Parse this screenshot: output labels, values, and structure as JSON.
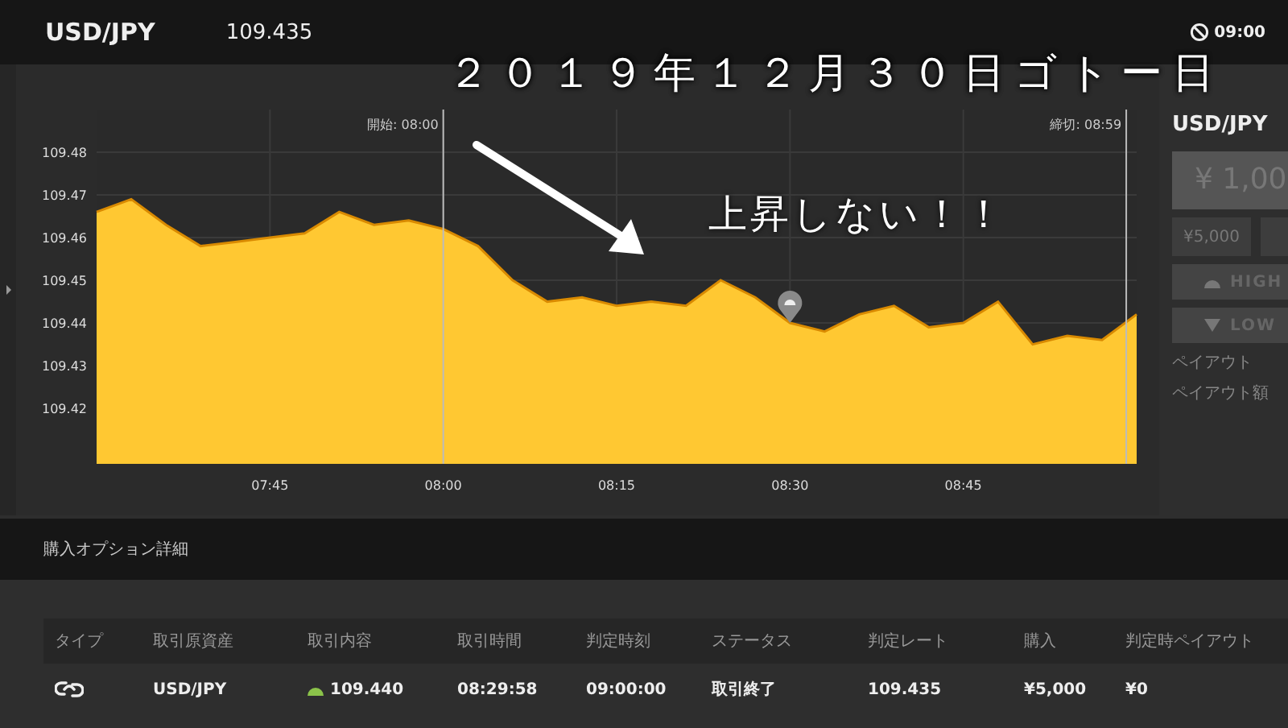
{
  "header": {
    "symbol": "USD/JPY",
    "price": "109.435",
    "expiry": "09:00"
  },
  "overlay": {
    "title": "２０１９年１２月３０日ゴトー日",
    "caption": "上昇しない！！"
  },
  "chart": {
    "chart_data": {
      "type": "area",
      "categories": [
        null,
        null,
        null,
        null,
        null,
        "07:45",
        null,
        null,
        null,
        null,
        "08:00",
        null,
        null,
        null,
        null,
        "08:15",
        null,
        null,
        null,
        null,
        "08:30",
        null,
        null,
        null,
        null,
        "08:45",
        null,
        null,
        null,
        null,
        null
      ],
      "series": [
        {
          "color": "#ffc832",
          "values": [
            109.466,
            109.469,
            109.463,
            109.458,
            109.459,
            109.46,
            109.461,
            109.466,
            109.463,
            109.464,
            109.462,
            109.458,
            109.45,
            109.445,
            109.446,
            109.444,
            109.445,
            109.444,
            109.45,
            109.446,
            109.44,
            109.438,
            109.442,
            109.444,
            109.439,
            109.44,
            109.445,
            109.435,
            109.437,
            109.436,
            109.442
          ]
        }
      ],
      "ylim": [
        109.407,
        109.49
      ],
      "yticks": [
        109.42,
        109.43,
        109.44,
        109.45,
        109.46,
        109.47,
        109.48
      ],
      "grid": true
    },
    "markers": [
      {
        "label": "開始: 08:00"
      },
      {
        "label": "締切: 08:59"
      }
    ]
  },
  "trade_panel": {
    "symbol": "USD/JPY",
    "amount": "¥ 1,00",
    "quick_amount": "¥5,000",
    "high_button": "HIGH",
    "low_button": "LOW",
    "payout_label": "ペイアウト",
    "payout_amount_label": "ペイアウト額"
  },
  "details": {
    "title": "購入オプション詳細",
    "columns": [
      "タイプ",
      "取引原資産",
      "取引内容",
      "取引時間",
      "判定時刻",
      "ステータス",
      "判定レート",
      "購入",
      "判定時ペイアウト"
    ],
    "rows": [
      {
        "asset": "USD/JPY",
        "up": true,
        "rate": "109.440",
        "trade_time": "08:29:58",
        "judge_time": "09:00:00",
        "status": "取引終了",
        "judge_rate": "109.435",
        "purchase": "¥5,000",
        "payout": "¥0"
      }
    ]
  }
}
